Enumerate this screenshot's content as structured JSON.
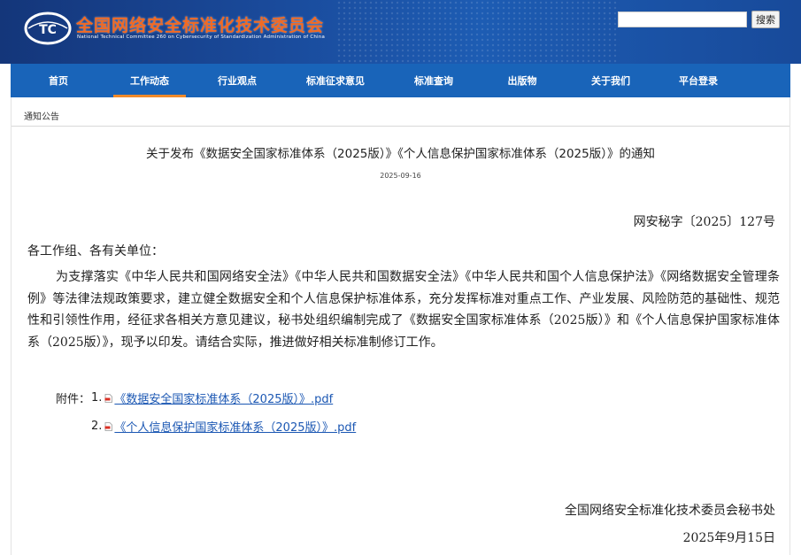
{
  "header": {
    "logo_text": "TC",
    "title": "全国网络安全标准化技术委员会",
    "subtitle": "National Technical Committee 260 on Cybersecurity of Standardization Administration of China",
    "search": {
      "value": "",
      "button_label": "搜索"
    }
  },
  "nav": {
    "items": [
      {
        "label": "首页"
      },
      {
        "label": "工作动态",
        "active": true
      },
      {
        "label": "行业观点"
      },
      {
        "label": "标准征求意见"
      },
      {
        "label": "标准查询"
      },
      {
        "label": "出版物"
      },
      {
        "label": "关于我们"
      },
      {
        "label": "平台登录"
      }
    ]
  },
  "breadcrumb": "通知公告",
  "article": {
    "title": "关于发布《数据安全国家标准体系（2025版）》《个人信息保护国家标准体系（2025版）》的通知",
    "date": "2025-09-16",
    "doc_number": "网安秘字〔2025〕127号",
    "salutation": "各工作组、各有关单位：",
    "body": "为支撑落实《中华人民共和国网络安全法》《中华人民共和国数据安全法》《中华人民共和国个人信息保护法》《网络数据安全管理条例》等法律法规政策要求，建立健全数据安全和个人信息保护标准体系，充分发挥标准对重点工作、产业发展、风险防范的基础性、规范性和引领性作用，经征求各相关方意见建议，秘书处组织编制完成了《数据安全国家标准体系（2025版）》和《个人信息保护国家标准体系（2025版）》，现予以印发。请结合实际，推进做好相关标准制修订工作。",
    "attachments_label": "附件：",
    "attachments": [
      {
        "num": "1.",
        "name": "《数据安全国家标准体系（2025版）》.pdf"
      },
      {
        "num": "2.",
        "name": "《个人信息保护国家标准体系（2025版）》.pdf"
      }
    ],
    "signature": "全国网络安全标准化技术委员会秘书处",
    "sign_date": "2025年9月15日"
  },
  "colors": {
    "banner": "#1a4b9c",
    "nav": "#1964b9",
    "title_orange": "#f26a23",
    "active_underline": "#f08a2a",
    "link": "#1b57b3"
  },
  "icons": [
    "tc-logo-icon",
    "pdf-file-icon"
  ]
}
